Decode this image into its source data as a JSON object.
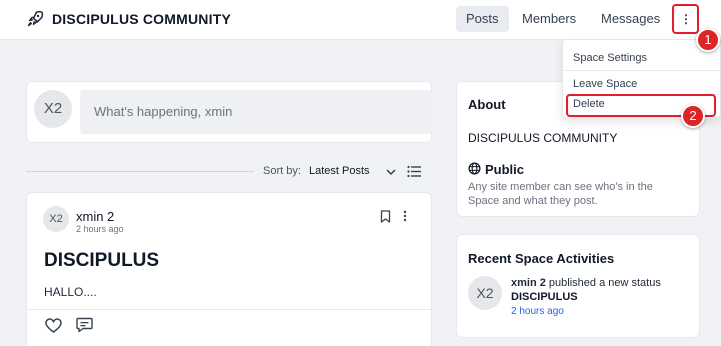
{
  "header": {
    "brand": "DISCIPULUS COMMUNITY",
    "tabs": [
      {
        "label": "Posts",
        "active": true
      },
      {
        "label": "Members",
        "active": false
      },
      {
        "label": "Messages",
        "active": false
      }
    ],
    "menu_glyph": "⋮"
  },
  "dropdown": {
    "items": [
      "Space Settings",
      "Leave Space",
      "Delete"
    ]
  },
  "annotations": {
    "step1": "1",
    "step2": "2"
  },
  "composer": {
    "avatar": "X2",
    "placeholder": "What's happening, xmin"
  },
  "sort": {
    "label": "Sort by:",
    "value": "Latest Posts"
  },
  "post": {
    "avatar": "X2",
    "author": "xmin 2",
    "time": "2 hours ago",
    "title": "DISCIPULUS",
    "body": "HALLO...."
  },
  "about": {
    "title": "About",
    "space_name": "DISCIPULUS COMMUNITY",
    "privacy": "Public",
    "privacy_desc_1": "Any site member can see who's in the",
    "privacy_desc_2": "Space and what they post."
  },
  "activities": {
    "title": "Recent Space Activities",
    "avatar": "X2",
    "user": "xmin 2",
    "action": " published a new status",
    "subject": "DISCIPULUS",
    "time": "2 hours ago"
  },
  "colors": {
    "accent_red": "#dc2626",
    "link_blue": "#2563eb",
    "background": "#f0f2f5"
  }
}
